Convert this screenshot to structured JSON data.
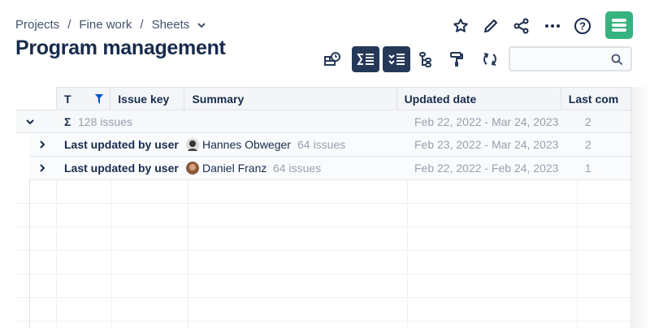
{
  "breadcrumbs": [
    "Projects",
    "Fine work",
    "Sheets"
  ],
  "title": "Program management",
  "header_icons": [
    "star-icon",
    "pencil-icon",
    "share-icon",
    "more-icon",
    "help-icon"
  ],
  "toolbar": [
    "add-view-icon",
    "sum-icon",
    "checklist-icon",
    "hierarchy-icon",
    "paint-roller-icon",
    "refresh-icon"
  ],
  "search": {
    "placeholder": ""
  },
  "columns": [
    "T",
    "Issue key",
    "Summary",
    "Updated date",
    "Last com"
  ],
  "total": {
    "symbol": "Σ",
    "count": "128 issues",
    "updated": "Feb 22, 2022 - Mar 24, 2023",
    "last": "2"
  },
  "groups": [
    {
      "label": "Last updated by user",
      "user": "Hannes Obweger",
      "count": "64 issues",
      "updated": "Feb 23, 2022 - Mar 24, 2023",
      "last": "2"
    },
    {
      "label": "Last updated by user",
      "user": "Daniel Franz",
      "count": "64 issues",
      "updated": "Feb 22, 2022 - Feb 24, 2023",
      "last": "1"
    }
  ],
  "colors": {
    "accent": "#253858",
    "logo": "#36b37e",
    "filter": "#0052cc"
  }
}
